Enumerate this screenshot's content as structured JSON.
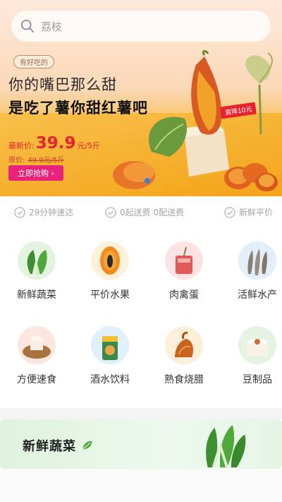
{
  "search": {
    "placeholder": "荔枝"
  },
  "banner": {
    "tag": "有好吃的",
    "headline_1": "你的嘴巴那么甜",
    "headline_2": "是吃了薯你甜红薯吧",
    "price_label": "最新价:",
    "price": "39.9",
    "price_unit": "元/5斤",
    "orig_label": "原价:",
    "orig_price": "49.9元/5斤",
    "buy_button": "立即抢购 ›",
    "drop_tag": "直降10元"
  },
  "features": [
    {
      "label": "29分钟速达",
      "icon": "check-circle-icon"
    },
    {
      "label": "0起送费 0配送费",
      "icon": "check-circle-icon"
    },
    {
      "label": "新鲜平价",
      "icon": "check-circle-icon"
    }
  ],
  "categories": [
    {
      "label": "新鲜蔬菜",
      "icon": "vegetable-icon",
      "bg": "#e4f3df"
    },
    {
      "label": "平价水果",
      "icon": "papaya-icon",
      "bg": "#fdf1d9"
    },
    {
      "label": "肉禽蛋",
      "icon": "meat-icon",
      "bg": "#fde3e3"
    },
    {
      "label": "活鲜水产",
      "icon": "shrimp-icon",
      "bg": "#e3eefb"
    },
    {
      "label": "方便速食",
      "icon": "instant-food-icon",
      "bg": "#fde6e0"
    },
    {
      "label": "酒水饮料",
      "icon": "drink-icon",
      "bg": "#e2f0fb"
    },
    {
      "label": "熟食烧腊",
      "icon": "roast-duck-icon",
      "bg": "#fdefd9"
    },
    {
      "label": "豆制品",
      "icon": "tofu-icon",
      "bg": "#e6f3e3"
    }
  ],
  "section": {
    "title": "新鲜蔬菜"
  },
  "colors": {
    "accent": "#e8222f",
    "buy_button": "#e9237b",
    "check": "#b5b5b5"
  }
}
